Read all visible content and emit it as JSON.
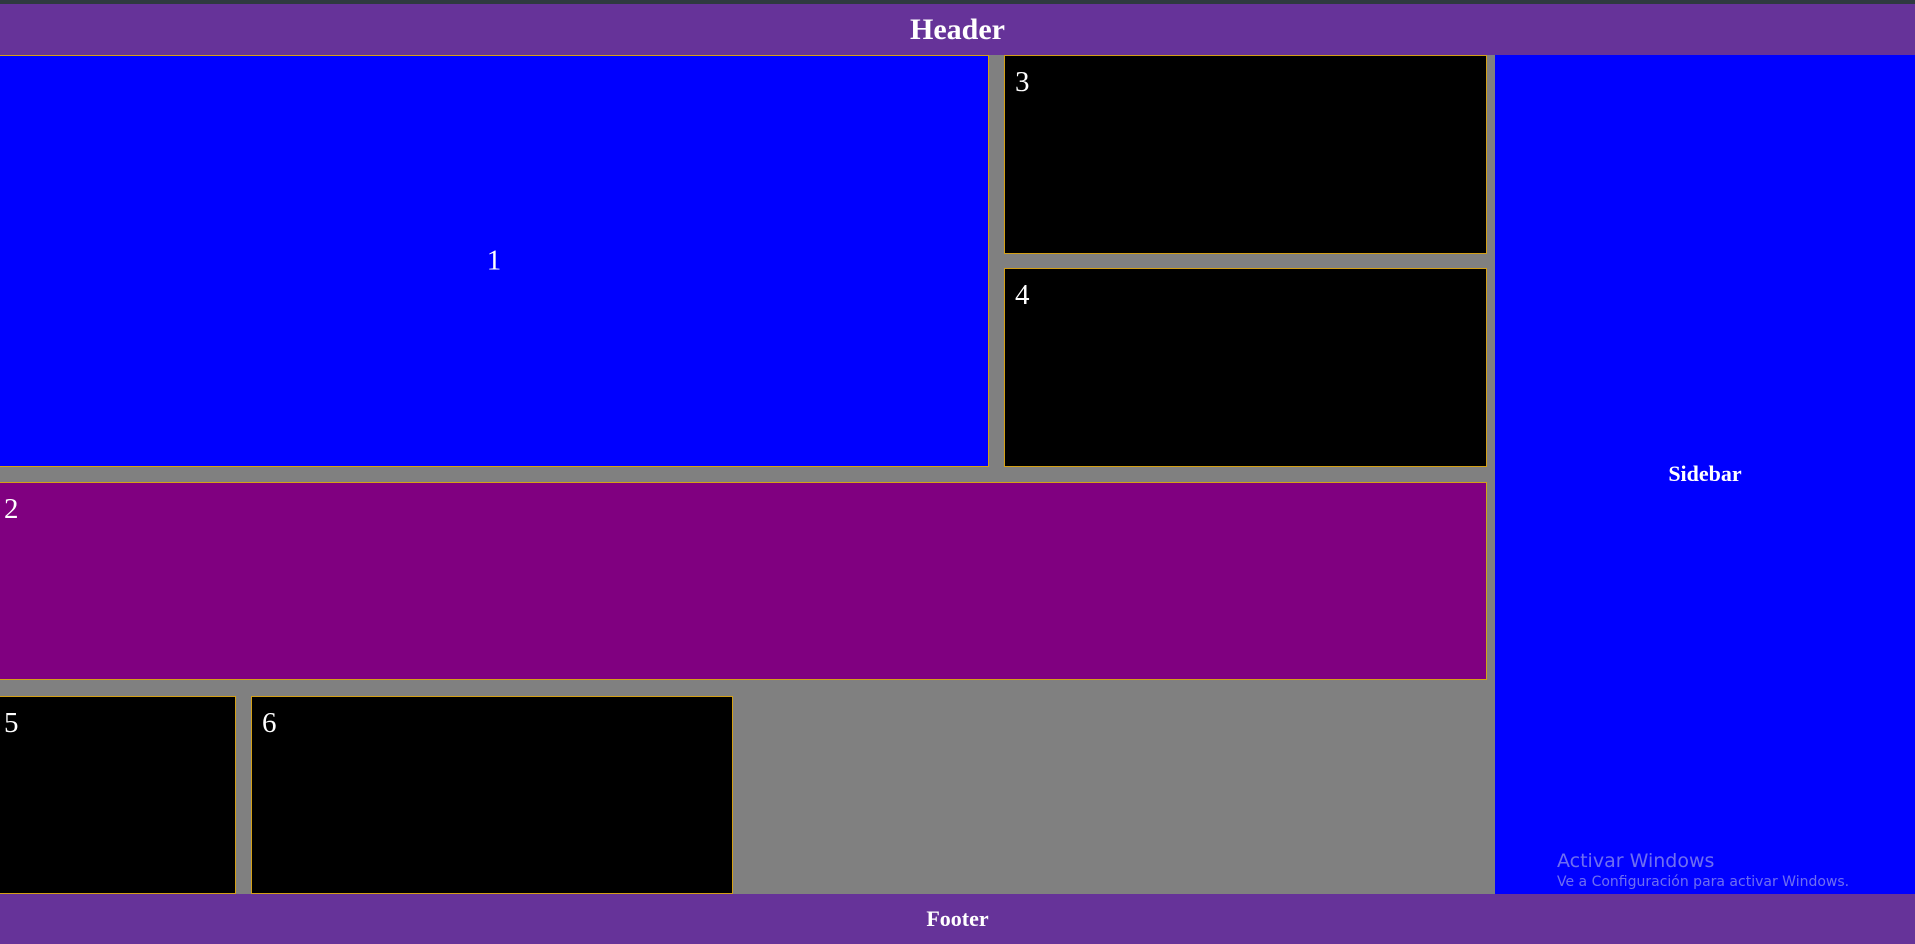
{
  "header": {
    "title": "Header"
  },
  "boxes": {
    "box1": {
      "label": "1",
      "color": "#0000ff"
    },
    "box2": {
      "label": "2",
      "color": "#800080"
    },
    "box3": {
      "label": "3",
      "color": "#000000"
    },
    "box4": {
      "label": "4",
      "color": "#000000"
    },
    "box5": {
      "label": "5",
      "color": "#000000"
    },
    "box6": {
      "label": "6",
      "color": "#000000"
    }
  },
  "sidebar": {
    "label": "Sidebar",
    "color": "#0000ff"
  },
  "footer": {
    "title": "Footer"
  },
  "watermark": {
    "title": "Activar Windows",
    "subtitle": "Ve a Configuración para activar Windows."
  },
  "colors": {
    "header_footer": "#663399",
    "background": "#808080",
    "border": "#d4a017"
  }
}
